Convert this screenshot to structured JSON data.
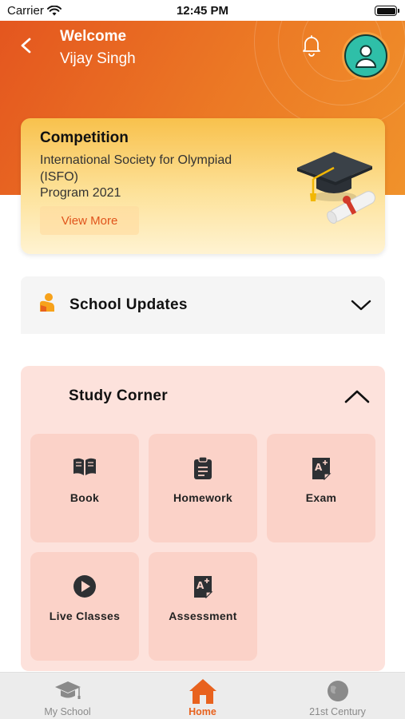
{
  "status_bar": {
    "carrier": "Carrier",
    "time": "12:45 PM"
  },
  "header": {
    "welcome": "Welcome",
    "user_name": "Vijay Singh"
  },
  "competition": {
    "title": "Competition",
    "description_line1": "International Society for Olympiad",
    "description_line2": "(ISFO)",
    "description_line3": "Program 2021",
    "view_more_label": "View More"
  },
  "school_updates": {
    "label": "School Updates",
    "expanded": false
  },
  "study_corner": {
    "label": "Study Corner",
    "expanded": true,
    "items": [
      {
        "label": "Book",
        "icon": "book-icon"
      },
      {
        "label": "Homework",
        "icon": "clipboard-icon"
      },
      {
        "label": "Exam",
        "icon": "exam-icon"
      },
      {
        "label": "Live Classes",
        "icon": "play-icon"
      },
      {
        "label": "Assessment",
        "icon": "assessment-icon"
      }
    ]
  },
  "tabbar": {
    "tabs": [
      {
        "label": "My School",
        "icon": "graduation-cap-icon",
        "active": false
      },
      {
        "label": "Home",
        "icon": "home-icon",
        "active": true
      },
      {
        "label": "21st Century",
        "icon": "globe-icon",
        "active": false
      }
    ]
  },
  "colors": {
    "brand_orange": "#e8621e",
    "header_gradient_start": "#e4561f",
    "header_gradient_end": "#f0922b",
    "card_yellow": "#f8c14c",
    "study_bg": "#fde2dc",
    "tile_bg": "#fbd2c8",
    "avatar_teal": "#2fbfa8"
  }
}
